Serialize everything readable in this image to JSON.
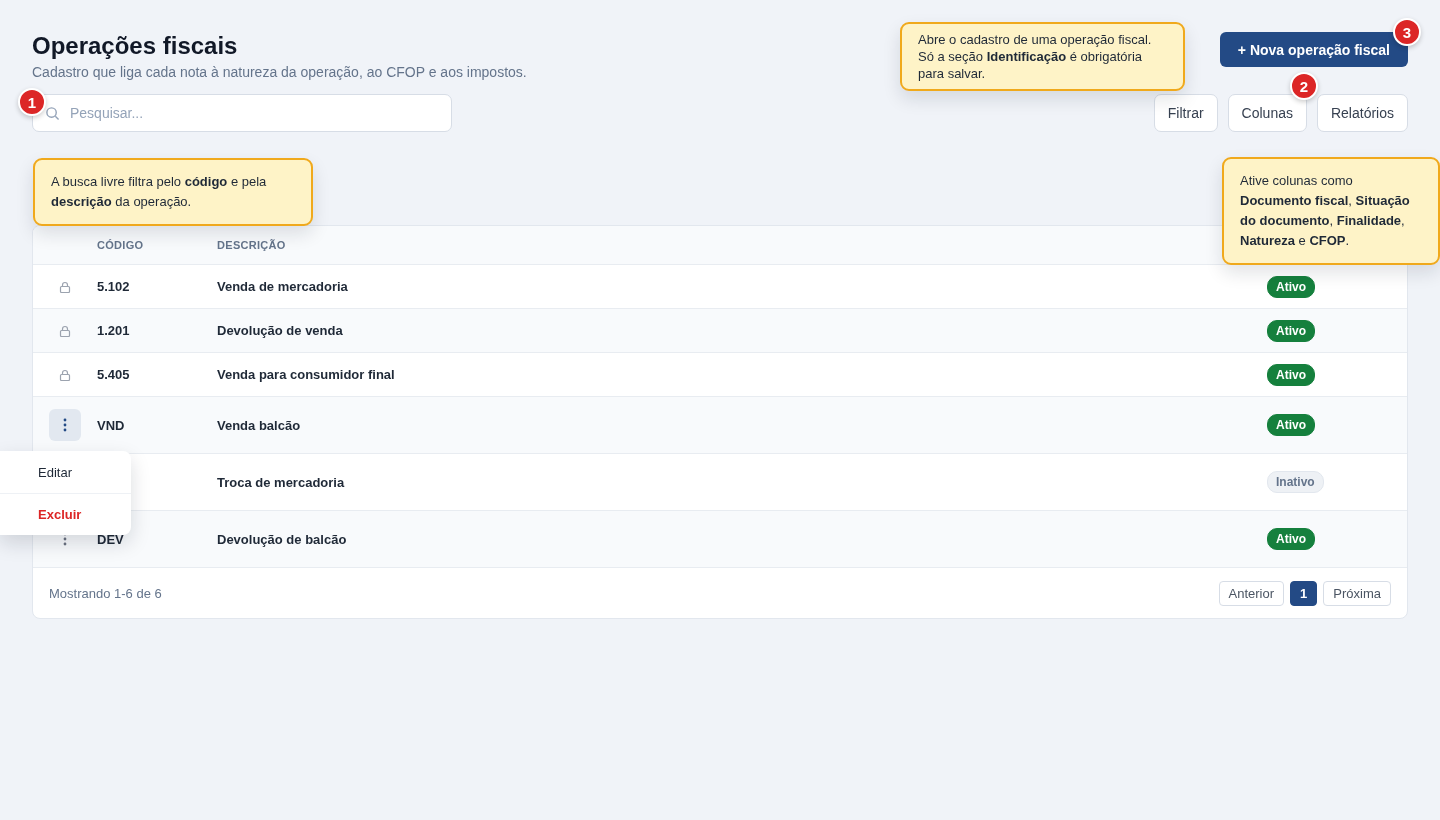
{
  "page": {
    "title": "Operações fiscais",
    "subtitle": "Cadastro que liga cada nota à natureza da operação, ao CFOP e aos impostos."
  },
  "search": {
    "placeholder": "Pesquisar..."
  },
  "new_button": {
    "label": "+ Nova operação fiscal"
  },
  "toolbar_buttons": [
    {
      "label": "Filtrar"
    },
    {
      "label": "Colunas"
    },
    {
      "label": "Relatórios"
    }
  ],
  "table": {
    "columns": [
      "CÓDIGO",
      "DESCRIÇÃO"
    ],
    "rows": [
      {
        "kind": "locked",
        "code": "5.102",
        "description": "Venda de mercadoria",
        "status": {
          "label": "Ativo",
          "active": true
        }
      },
      {
        "kind": "locked",
        "code": "1.201",
        "description": "Devolução de venda",
        "status": {
          "label": "Ativo",
          "active": true
        }
      },
      {
        "kind": "locked",
        "code": "5.405",
        "description": "Venda para consumidor final",
        "status": {
          "label": "Ativo",
          "active": true
        }
      },
      {
        "kind": "menu",
        "menu_open": true,
        "code": "VND",
        "description": "Venda balcão",
        "status": {
          "label": "Ativo",
          "active": true
        }
      },
      {
        "description": "Troca de mercadoria",
        "status": {
          "label": "Inativo",
          "active": false
        }
      },
      {
        "kind": "menu",
        "menu_open": false,
        "code": "DEV",
        "description": "Devolução de balcão",
        "status": {
          "label": "Ativo",
          "active": true
        }
      }
    ]
  },
  "footer": {
    "summary": "Mostrando 1-6 de 6"
  },
  "pagination": {
    "previous": "Anterior",
    "pages": [
      {
        "label": "1",
        "selected": true
      }
    ],
    "next": "Próxima"
  },
  "row_menu": {
    "items": [
      {
        "label": "Editar",
        "kind": "normal"
      },
      {
        "label": "Excluir",
        "kind": "danger"
      }
    ]
  },
  "callouts": [
    {
      "number": "3",
      "text": "Abre o cadastro de uma operação fiscal. Só a seção **Identificação** é obrigatória para salvar."
    },
    {
      "number": "1",
      "text": "A busca livre filtra pelo **código** e pela **descrição** da operação."
    },
    {
      "number": "2",
      "text": "Ative colunas como **Documento fiscal**, **Situação do documento**, **Finalidade**, **Natureza** e **CFOP**."
    }
  ]
}
